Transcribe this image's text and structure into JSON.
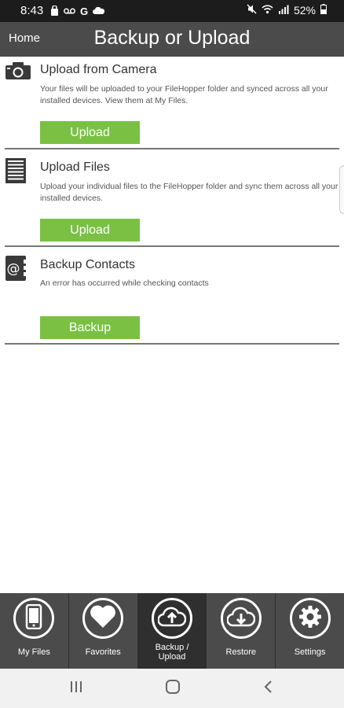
{
  "status_bar": {
    "time": "8:43",
    "battery": "52%"
  },
  "header": {
    "home_label": "Home",
    "title": "Backup or Upload"
  },
  "sections": [
    {
      "icon": "camera-icon",
      "title": "Upload from Camera",
      "description": "Your files will be uploaded to your FileHopper folder and synced across all your installed devices.  View them at My Files.",
      "button_label": "Upload"
    },
    {
      "icon": "file-icon",
      "title": "Upload Files",
      "description": "Upload your individual files to the FileHopper folder and sync them across all your installed devices.",
      "button_label": "Upload"
    },
    {
      "icon": "contact-book-icon",
      "title": "Backup Contacts",
      "description": "An error has occurred while checking contacts",
      "button_label": "Backup"
    }
  ],
  "bottom_nav": {
    "active": "Backup / Upload",
    "tabs": [
      {
        "label": "My Files",
        "icon": "phone-icon"
      },
      {
        "label": "Favorites",
        "icon": "heart-icon"
      },
      {
        "label": "Backup /\nUpload",
        "icon": "cloud-upload-icon"
      },
      {
        "label": "Restore",
        "icon": "cloud-download-icon"
      },
      {
        "label": "Settings",
        "icon": "gear-icon"
      }
    ]
  },
  "colors": {
    "header_bg": "#4b4b4b",
    "button_green": "#7ac143",
    "active_tab_bg": "#2f2f2f"
  }
}
